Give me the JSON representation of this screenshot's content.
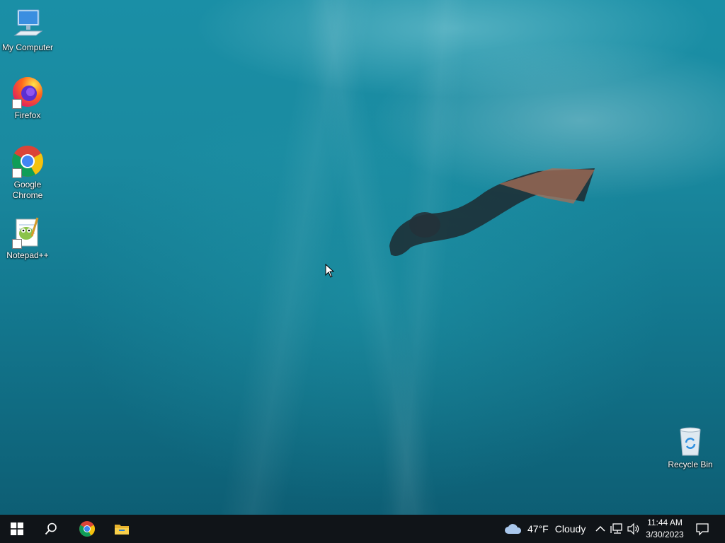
{
  "desktop": {
    "icons": [
      {
        "label": "My Computer",
        "icon": "computer-icon"
      },
      {
        "label": "Firefox",
        "icon": "firefox-icon"
      },
      {
        "label": "Google Chrome",
        "icon": "chrome-icon"
      },
      {
        "label": "Notepad++",
        "icon": "notepadpp-icon"
      },
      {
        "label": "Recycle Bin",
        "icon": "recycle-bin-icon"
      }
    ]
  },
  "taskbar": {
    "start_icon": "windows-logo-icon",
    "search_icon": "search-icon",
    "pinned": [
      {
        "name": "Google Chrome",
        "icon": "chrome-icon"
      },
      {
        "name": "File Explorer",
        "icon": "folder-icon"
      }
    ],
    "weather": {
      "temperature": "47°F",
      "condition": "Cloudy",
      "icon": "cloud-icon"
    },
    "tray_icons": [
      "chevron-up-icon",
      "network-icon",
      "volume-icon"
    ],
    "clock": {
      "time": "11:44 AM",
      "date": "3/30/2023"
    },
    "notification_icon": "notification-icon"
  },
  "colors": {
    "taskbar": "#101418",
    "desktop_water": "#1a8aa0"
  }
}
